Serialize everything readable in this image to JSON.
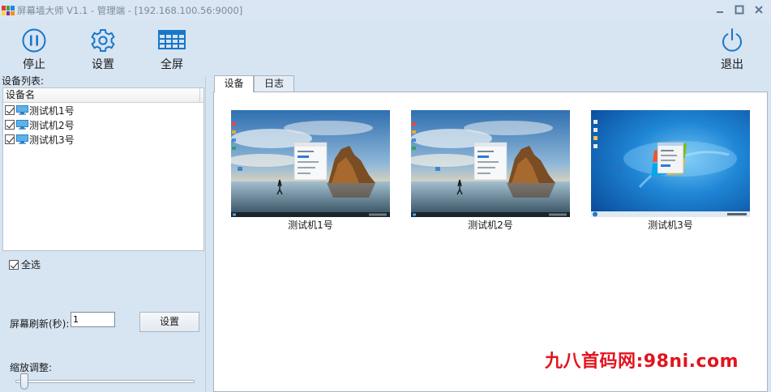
{
  "window": {
    "title": "屏幕墙大师 V1.1 - 管理端 - [192.168.100.56:9000]",
    "controls": [
      "minimize-icon",
      "maximize-icon",
      "close-icon"
    ]
  },
  "toolbar": {
    "stop_label": "停止",
    "settings_label": "设置",
    "fullscreen_label": "全屏",
    "exit_label": "退出"
  },
  "left_panel": {
    "device_list_label": "设备列表:",
    "column_header": "设备名",
    "devices": [
      {
        "name": "测试机1号",
        "checked": true
      },
      {
        "name": "测试机2号",
        "checked": true
      },
      {
        "name": "测试机3号",
        "checked": true
      }
    ],
    "select_all_label": "全选",
    "select_all_checked": true,
    "refresh_label": "屏幕刷新(秒):",
    "refresh_value": "1",
    "set_button_label": "设置",
    "zoom_label": "缩放调整:",
    "zoom_level": 0.03
  },
  "tabs": [
    {
      "label": "设备",
      "active": true
    },
    {
      "label": "日志",
      "active": false
    }
  ],
  "screens": [
    {
      "caption": "测试机1号",
      "wallpaper": "coastal-rock-sunset"
    },
    {
      "caption": "测试机2号",
      "wallpaper": "coastal-rock-sunset"
    },
    {
      "caption": "测试机3号",
      "wallpaper": "windows-7-blue"
    }
  ],
  "watermark": "九八首码网:98ni.com",
  "colors": {
    "accent": "#1877c9",
    "window_bg": "#d7e4f2",
    "watermark": "#e2141e"
  }
}
